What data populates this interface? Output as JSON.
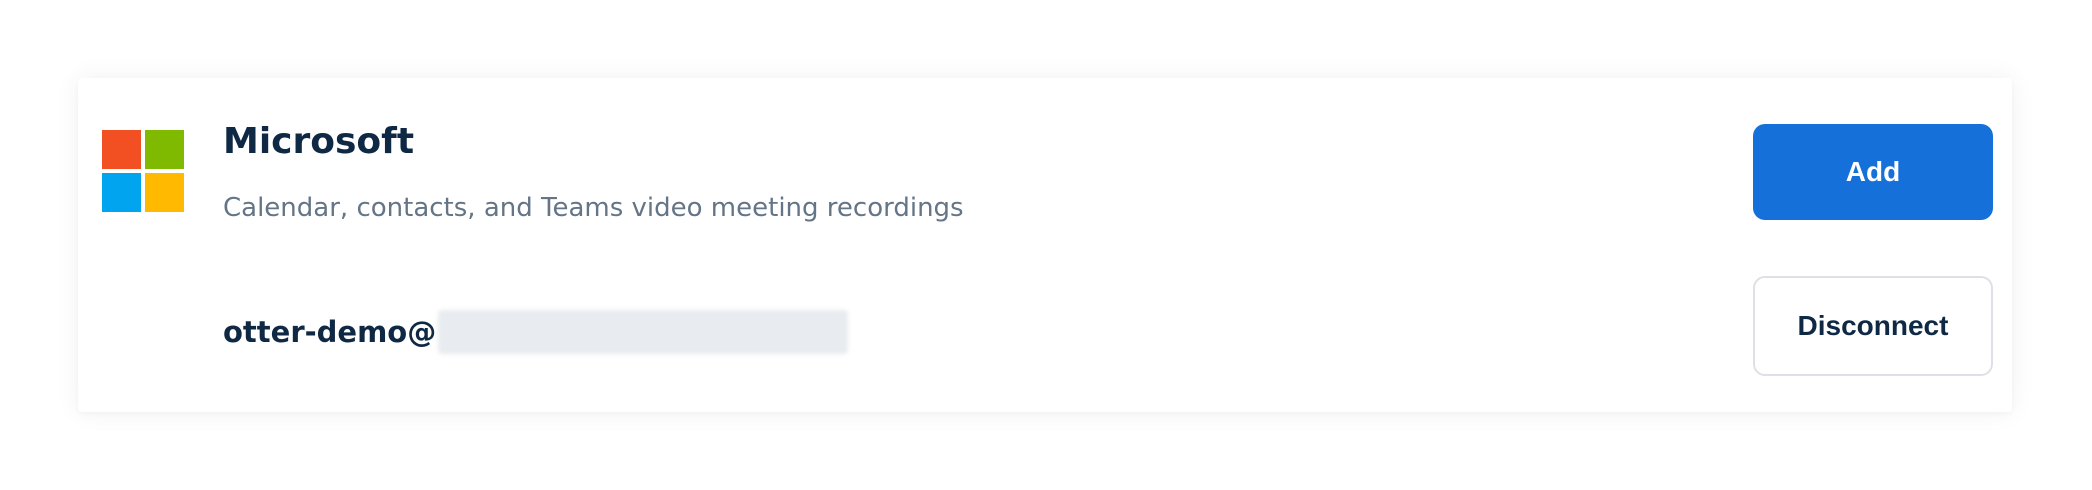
{
  "integration": {
    "name": "Microsoft",
    "description": "Calendar, contacts, and Teams video meeting recordings",
    "logo_icon": "microsoft-logo-icon",
    "logo_colors": [
      "#F25022",
      "#7FBA00",
      "#00A4EF",
      "#FFB900"
    ]
  },
  "actions": {
    "add_label": "Add",
    "disconnect_label": "Disconnect"
  },
  "account": {
    "email_user": "otter-demo@"
  },
  "colors": {
    "primary": "#1570d9",
    "text_dark": "#0f2844",
    "text_muted": "#647587"
  }
}
